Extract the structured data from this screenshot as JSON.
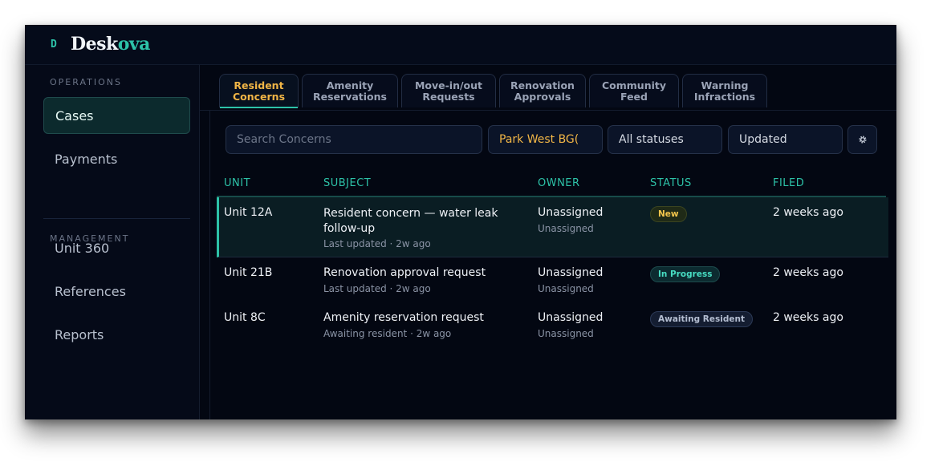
{
  "brand": {
    "mark": "D",
    "name_part1": "Desk",
    "name_part2": "ova"
  },
  "sidebar": {
    "operations_label": "OPERATIONS",
    "management_label": "MANAGEMENT",
    "operations_items": [
      {
        "label": "Cases",
        "active": true
      },
      {
        "label": "Payments",
        "active": false
      }
    ],
    "management_items": [
      {
        "label": "Unit 360"
      },
      {
        "label": "References"
      },
      {
        "label": "Reports"
      }
    ]
  },
  "tabs": [
    {
      "label": "Resident Concerns",
      "active": true
    },
    {
      "label": "Amenity Reservations",
      "active": false
    },
    {
      "label": "Move-in/out Requests",
      "active": false
    },
    {
      "label": "Renovation Approvals",
      "active": false
    },
    {
      "label": "Community Feed",
      "active": false
    },
    {
      "label": "Warning Infractions",
      "active": false
    }
  ],
  "filters": {
    "search_placeholder": "Search Concerns",
    "property": "Park West BG(",
    "status": "All statuses",
    "sort": "Updated",
    "settings_icon": "gear-icon"
  },
  "table": {
    "columns": [
      "UNIT",
      "SUBJECT",
      "OWNER",
      "STATUS",
      "FILED"
    ],
    "rows": [
      {
        "unit": "Unit 12A",
        "subject": "Resident concern — water leak follow-up",
        "subject_meta": "Last updated · 2w ago",
        "owner": "Unassigned",
        "owner_sub": "Unassigned",
        "status": "New",
        "filed": "2 weeks ago",
        "selected": true
      },
      {
        "unit": "Unit 21B",
        "subject": "Renovation approval request",
        "subject_meta": "Last updated · 2w ago",
        "owner": "Unassigned",
        "owner_sub": "Unassigned",
        "status": "In Progress",
        "filed": "2 weeks ago",
        "selected": false
      },
      {
        "unit": "Unit 8C",
        "subject": "Amenity reservation request",
        "subject_meta": "Awaiting resident · 2w ago",
        "owner": "Unassigned",
        "owner_sub": "Unassigned",
        "status": "Awaiting Resident",
        "filed": "2 weeks ago",
        "selected": false
      }
    ]
  },
  "colors": {
    "accent_teal": "#2dc2a8",
    "accent_amber": "#f0b546",
    "background": "#030712"
  }
}
